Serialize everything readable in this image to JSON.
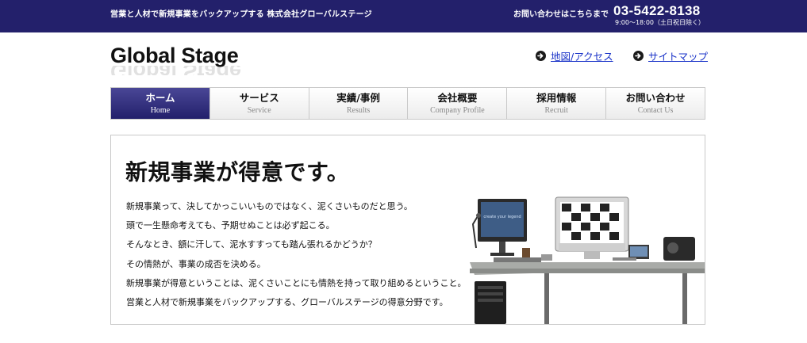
{
  "topbar": {
    "tagline": "営業と人材で新規事業をバックアップする 株式会社グローバルステージ",
    "contact_lead": "お問い合わせはこちらまで",
    "phone": "03-5422-8138",
    "hours": "9:00〜18:00（土日祝日除く）"
  },
  "header": {
    "logo": "Global Stage",
    "links": [
      {
        "label": "地図/アクセス",
        "icon": "arrow-circle-icon"
      },
      {
        "label": "サイトマップ",
        "icon": "arrow-circle-icon"
      }
    ]
  },
  "nav": {
    "items": [
      {
        "jp": "ホーム",
        "en": "Home",
        "active": true
      },
      {
        "jp": "サービス",
        "en": "Service",
        "active": false
      },
      {
        "jp": "実績/事例",
        "en": "Results",
        "active": false
      },
      {
        "jp": "会社概要",
        "en": "Company Profile",
        "active": false
      },
      {
        "jp": "採用情報",
        "en": "Recruit",
        "active": false
      },
      {
        "jp": "お問い合わせ",
        "en": "Contact Us",
        "active": false
      }
    ]
  },
  "hero": {
    "title": "新規事業が得意です。",
    "lines": [
      "新規事業って、決してかっこいいものではなく、泥くさいものだと思う。",
      "頭で一生懸命考えても、予期せぬことは必ず起こる。",
      "そんなとき、額に汗して、泥水すすっても踏ん張れるかどうか？",
      "その情熱が、事業の成否を決める。",
      "新規事業が得意ということは、泥くさいことにも情熱を持って取り組めるということ。",
      "営業と人材で新規事業をバックアップする、グローバルステージの得意分野です。"
    ],
    "image": {
      "icon": "office-desk-photo",
      "screen_text": "create your legend"
    }
  },
  "colors": {
    "brand": "#23206b",
    "link": "#1a33c8",
    "border": "#c9c9c9"
  }
}
